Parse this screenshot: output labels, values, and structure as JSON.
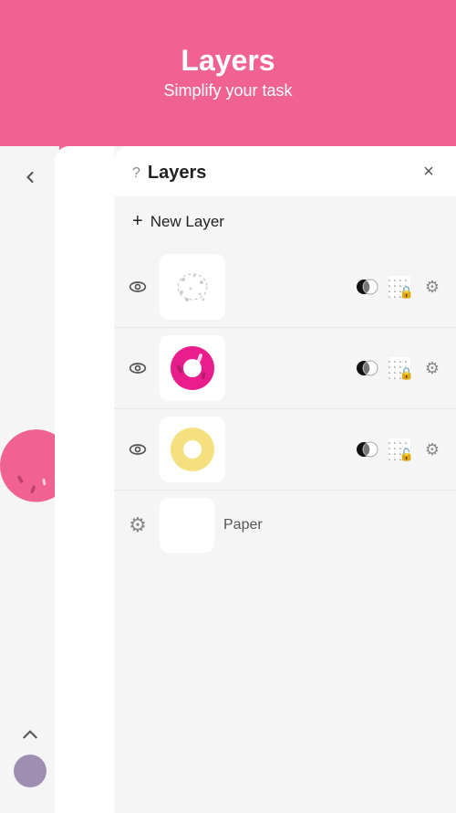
{
  "header": {
    "title": "Layers",
    "subtitle": "Simplify your task"
  },
  "panel": {
    "title": "Layers",
    "help_label": "?",
    "close_label": "×",
    "new_layer_label": "New Layer"
  },
  "layers": [
    {
      "id": "layer-1",
      "type": "sketch",
      "visible": true,
      "has_lock": true
    },
    {
      "id": "layer-2",
      "type": "donut-pink",
      "visible": true,
      "has_lock": true
    },
    {
      "id": "layer-3",
      "type": "donut-yellow",
      "visible": true,
      "has_lock": true
    },
    {
      "id": "layer-paper",
      "type": "paper",
      "label": "Paper",
      "visible": false
    }
  ],
  "colors": {
    "background": "#F06292",
    "panel_bg": "#f5f5f5",
    "white": "#ffffff",
    "text_dark": "#222222",
    "text_medium": "#555555",
    "accent_purple": "#9E8FB2"
  }
}
